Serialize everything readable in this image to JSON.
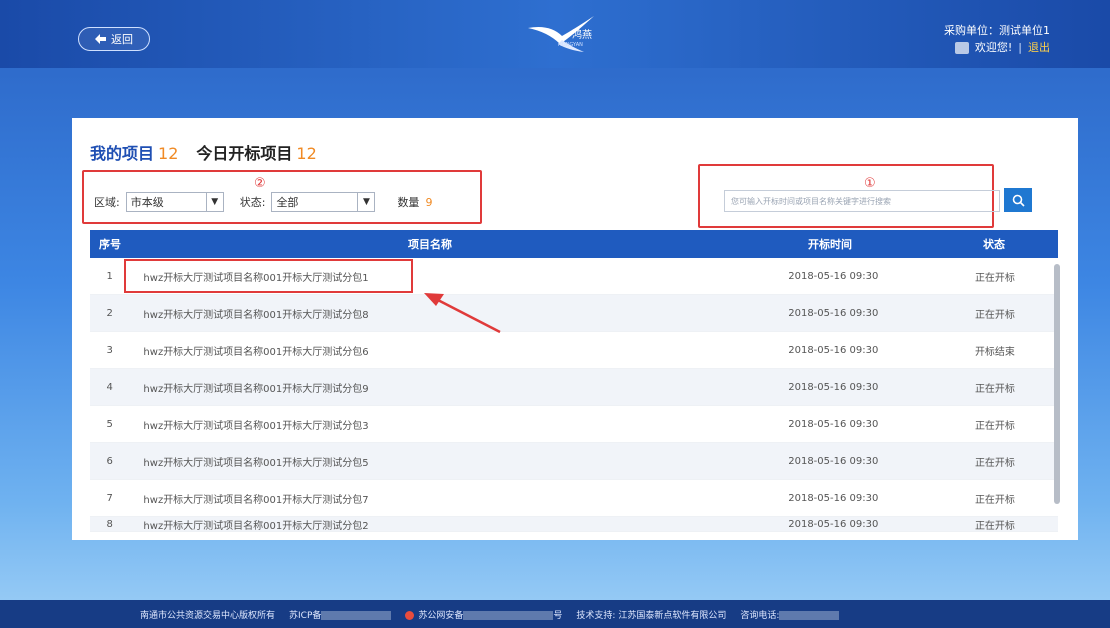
{
  "header": {
    "back_label": "返回",
    "logo_text": "鸿燕",
    "logo_sub": "HONGYAN",
    "unit_label": "采购单位：测试单位1",
    "welcome_label": "欢迎您!",
    "logout_label": "退出"
  },
  "tabs": [
    {
      "label": "我的项目",
      "count": "12"
    },
    {
      "label": "今日开标项目",
      "count": "12"
    }
  ],
  "filters": {
    "region_label": "区域:",
    "region_value": "市本级",
    "status_label": "状态:",
    "status_value": "全部",
    "count_label": "数量",
    "count_value": "9",
    "marker": "②"
  },
  "search": {
    "placeholder": "您可输入开标时间或项目名称关键字进行搜索",
    "marker": "①"
  },
  "table": {
    "headers": [
      "序号",
      "项目名称",
      "开标时间",
      "状态"
    ],
    "rows": [
      {
        "no": "1",
        "name": "hwz开标大厅测试项目名称001开标大厅测试分包1",
        "time": "2018-05-16 09:30",
        "status": "正在开标"
      },
      {
        "no": "2",
        "name": "hwz开标大厅测试项目名称001开标大厅测试分包8",
        "time": "2018-05-16 09:30",
        "status": "正在开标"
      },
      {
        "no": "3",
        "name": "hwz开标大厅测试项目名称001开标大厅测试分包6",
        "time": "2018-05-16 09:30",
        "status": "开标结束"
      },
      {
        "no": "4",
        "name": "hwz开标大厅测试项目名称001开标大厅测试分包9",
        "time": "2018-05-16 09:30",
        "status": "正在开标"
      },
      {
        "no": "5",
        "name": "hwz开标大厅测试项目名称001开标大厅测试分包3",
        "time": "2018-05-16 09:30",
        "status": "正在开标"
      },
      {
        "no": "6",
        "name": "hwz开标大厅测试项目名称001开标大厅测试分包5",
        "time": "2018-05-16 09:30",
        "status": "正在开标"
      },
      {
        "no": "7",
        "name": "hwz开标大厅测试项目名称001开标大厅测试分包7",
        "time": "2018-05-16 09:30",
        "status": "正在开标"
      },
      {
        "no": "8",
        "name": "hwz开标大厅测试项目名称001开标大厅测试分包2",
        "time": "2018-05-16 09:30",
        "status": "正在开标"
      }
    ]
  },
  "footer": {
    "copyright": "南通市公共资源交易中心版权所有",
    "icp": "苏ICP备",
    "police": "苏公网安备",
    "police_suffix": "号",
    "support": "技术支持: 江苏国泰新点软件有限公司",
    "phone": "咨询电话:"
  }
}
